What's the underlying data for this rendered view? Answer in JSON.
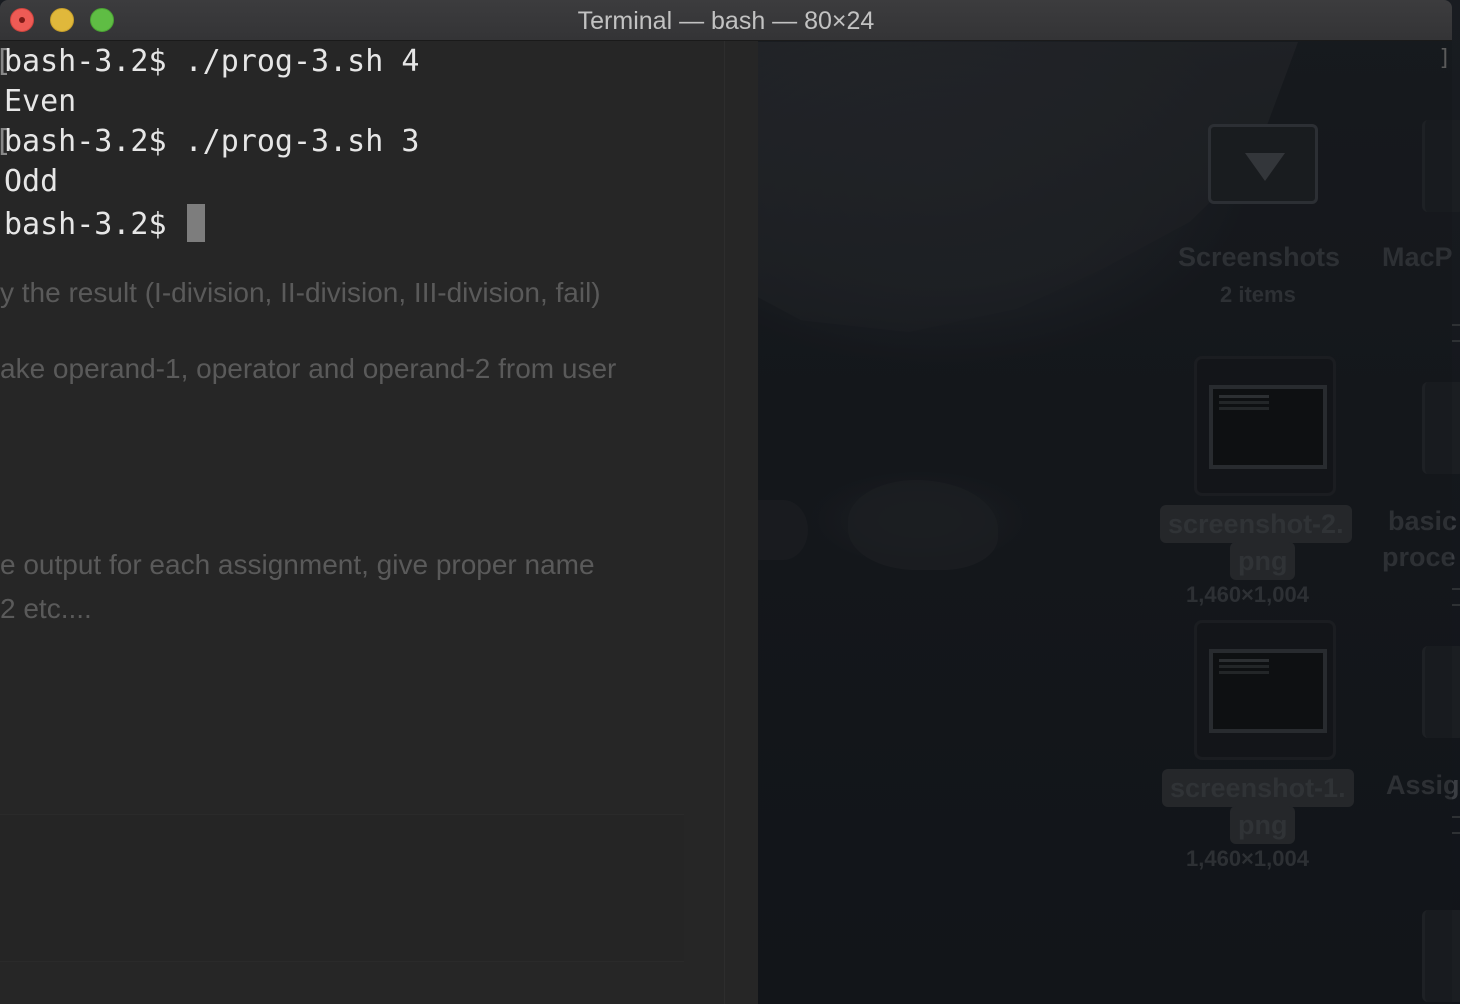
{
  "window": {
    "title": "Terminal — bash — 80×24"
  },
  "terminal": {
    "lines": [
      {
        "bracket": "[",
        "text": "bash-3.2$ ./prog-3.sh 4"
      },
      {
        "bracket": "",
        "text": "Even"
      },
      {
        "bracket": "[",
        "text": "bash-3.2$ ./prog-3.sh 3"
      },
      {
        "bracket": "",
        "text": "Odd"
      },
      {
        "bracket": "",
        "text": "bash-3.2$ "
      }
    ]
  },
  "background_document": {
    "lines": [
      "y the result (I-division, II-division, III-division, fail)",
      "ake operand-1, operator and operand-2 from user",
      "e output for each assignment, give proper name",
      "2 etc...."
    ]
  },
  "desktop": {
    "folder": {
      "name": "Screenshots",
      "meta": "2 items",
      "icon": "folder-download-icon"
    },
    "files": [
      {
        "name_line1": "screenshot-2.",
        "name_line2": "png",
        "meta": "1,460×1,004"
      },
      {
        "name_line1": "screenshot-1.",
        "name_line2": "png",
        "meta": "1,460×1,004"
      }
    ],
    "partial_labels": [
      {
        "line1": "MacP",
        "line2": ""
      },
      {
        "line1": "basic",
        "line2": "proce"
      },
      {
        "line1": "Assig",
        "line2": ""
      }
    ]
  },
  "colors": {
    "close": "#ee5b55",
    "minimize": "#e0b83b",
    "maximize": "#5fbd44",
    "terminal_text": "#e6e6e6",
    "terminal_bg": "#2a2a2a"
  }
}
